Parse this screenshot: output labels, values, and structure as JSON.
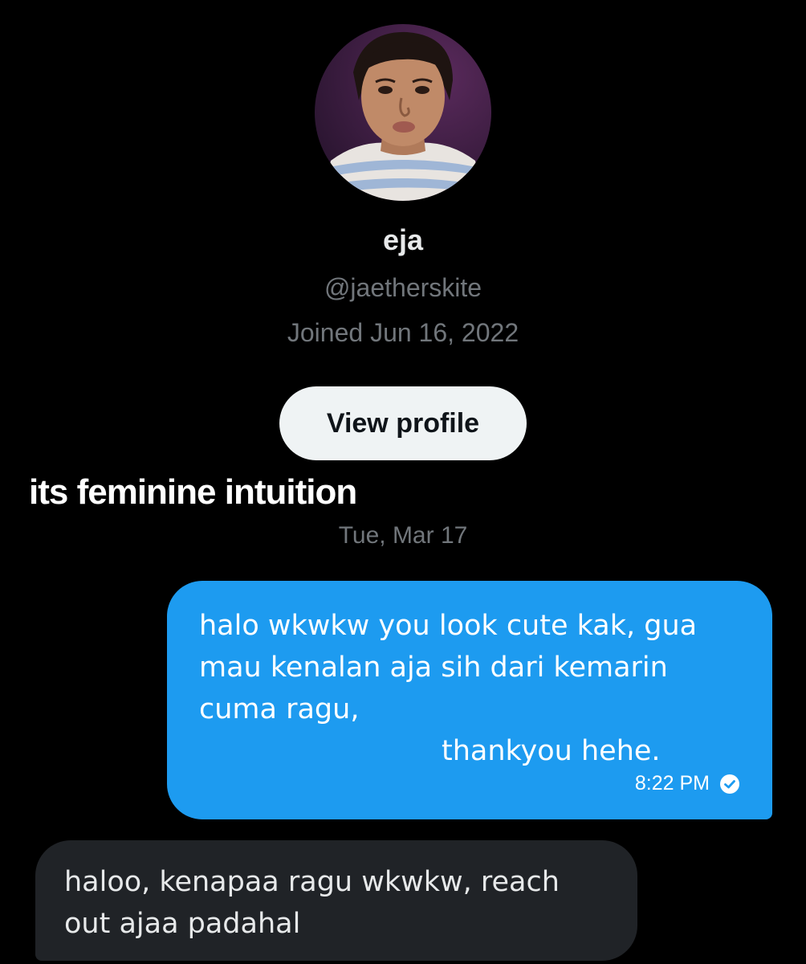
{
  "profile": {
    "display_name": "eja",
    "handle": "@jaetherskite",
    "joined": "Joined Jun 16, 2022",
    "view_profile_label": "View profile"
  },
  "caption": "its feminine intuition",
  "conversation": {
    "date_separator": "Tue, Mar 17",
    "messages": [
      {
        "direction": "sent",
        "lines": [
          "halo wkwkw you look cute kak, gua",
          "mau kenalan aja sih dari kemarin",
          "cuma ragu,",
          "thankyou hehe."
        ],
        "time": "8:22 PM",
        "status_icon": "check-circle-icon"
      },
      {
        "direction": "received",
        "lines": [
          "haloo, kenapaa ragu wkwkw, reach",
          "out ajaa padahal"
        ]
      }
    ]
  },
  "colors": {
    "background": "#000000",
    "sent_bubble": "#1d9bf0",
    "received_bubble": "#202327",
    "secondary_text": "#71767b",
    "button_bg": "#eff3f4"
  }
}
